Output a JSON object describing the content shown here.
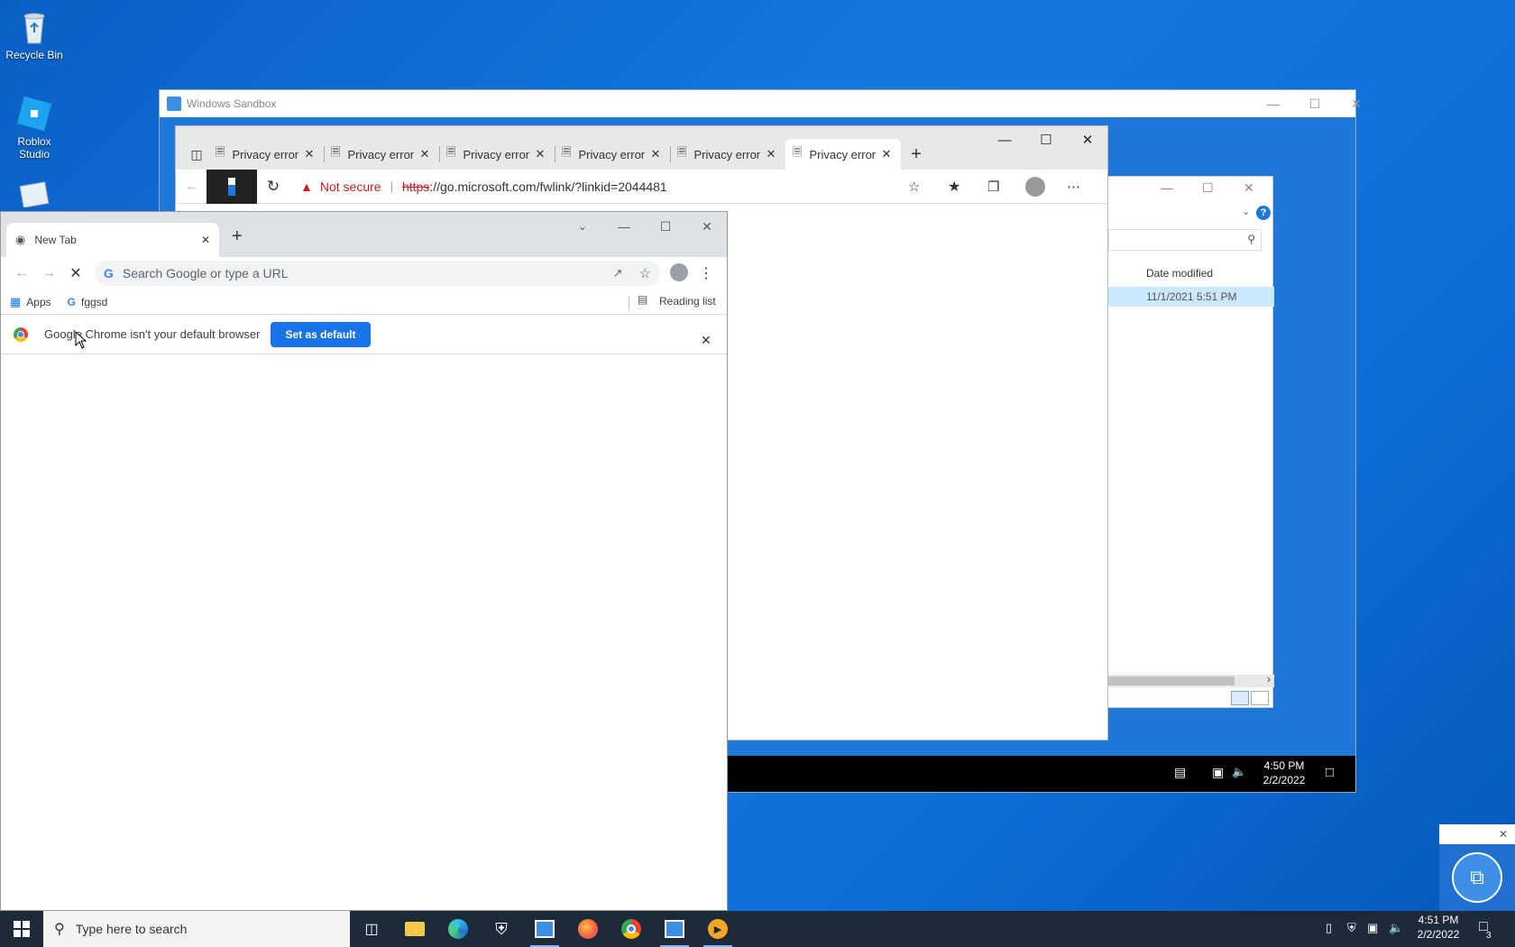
{
  "desktop": {
    "icons": [
      {
        "label": "Recycle Bin"
      },
      {
        "label": "Roblox Studio"
      }
    ]
  },
  "sandbox": {
    "title": "Windows Sandbox",
    "clock_time": "4:50 PM",
    "clock_date": "2/2/2022"
  },
  "explorer": {
    "column_header": "Date modified",
    "row_date": "11/1/2021 5:51 PM"
  },
  "edge": {
    "tabs": [
      {
        "label": "Privacy error"
      },
      {
        "label": "Privacy error"
      },
      {
        "label": "Privacy error"
      },
      {
        "label": "Privacy error"
      },
      {
        "label": "Privacy error"
      },
      {
        "label": "Privacy error"
      }
    ],
    "security_label": "Not secure",
    "url_scheme": "https",
    "url_rest": "://go.microsoft.com/fwlink/?linkid=2044481"
  },
  "chrome": {
    "tab_label": "New Tab",
    "omnibox_placeholder": "Search Google or type a URL",
    "bookmarks": {
      "apps": "Apps",
      "item1": "fggsd",
      "reading_list": "Reading list"
    },
    "infobar": {
      "message": "Google Chrome isn't your default browser",
      "button": "Set as default"
    }
  },
  "taskbar": {
    "search_placeholder": "Type here to search",
    "clock_time": "4:51 PM",
    "clock_date": "2/2/2022",
    "notification_count": "3"
  },
  "colors": {
    "desktop": "#0a64c8",
    "chrome_blue": "#1a73e8",
    "not_secure_red": "#c5221f"
  }
}
